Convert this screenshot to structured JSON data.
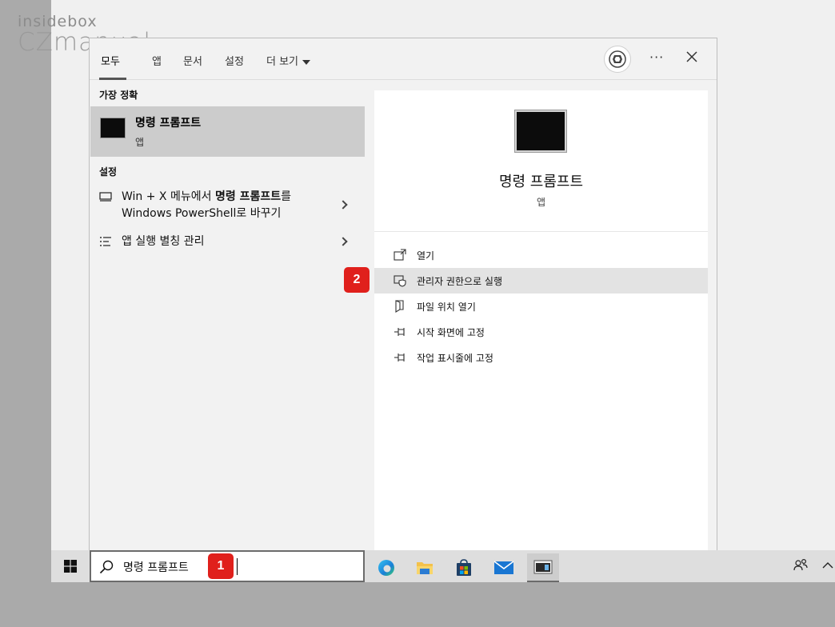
{
  "watermark": {
    "line1": "insidebox",
    "line2": "CZmanual"
  },
  "tabs": [
    {
      "label": "모두"
    },
    {
      "label": "앱"
    },
    {
      "label": "문서"
    },
    {
      "label": "설정"
    },
    {
      "label": "더 보기"
    }
  ],
  "more_options_label": "···",
  "sections": {
    "best_match": "가장 정확",
    "settings": "설정"
  },
  "best_match": {
    "title": "명령 프롬프트",
    "subtitle": "앱"
  },
  "settings_results": [
    {
      "label_line1_pre": "Win + X 메뉴에서 ",
      "label_line1_bold": "명령 프롬프트",
      "label_line1_post": "를",
      "label_line2": "Windows PowerShell로 바꾸기"
    },
    {
      "label": "앱 실행 별칭 관리"
    }
  ],
  "detail": {
    "title": "명령 프롬프트",
    "subtitle": "앱",
    "actions": [
      {
        "label": "열기",
        "icon": "open-icon"
      },
      {
        "label": "관리자 권한으로 실행",
        "icon": "shield-admin-icon"
      },
      {
        "label": "파일 위치 열기",
        "icon": "file-location-icon"
      },
      {
        "label": "시작 화면에 고정",
        "icon": "pin-icon"
      },
      {
        "label": "작업 표시줄에 고정",
        "icon": "pin-icon"
      }
    ]
  },
  "badges": {
    "step1": "1",
    "step2": "2"
  },
  "search": {
    "value": "명령 프롬프트"
  },
  "colors": {
    "badge": "#e0201c",
    "hover": "#e3e3e3",
    "selected": "#cccccc"
  }
}
